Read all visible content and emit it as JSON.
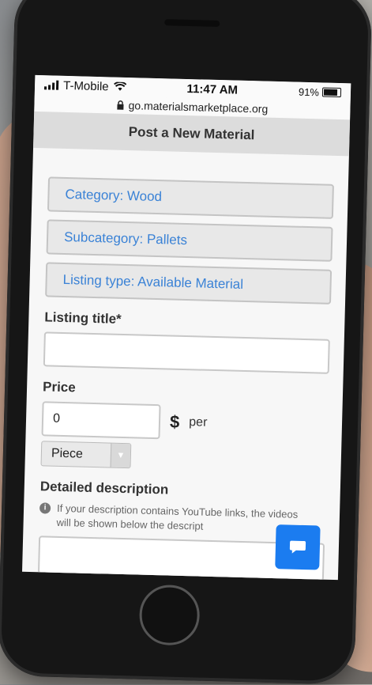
{
  "status_bar": {
    "carrier": "T-Mobile",
    "time": "11:47 AM",
    "battery": "91%"
  },
  "browser": {
    "url": "go.materialsmarketplace.org"
  },
  "header": {
    "title": "Post a New Material"
  },
  "form": {
    "category": "Category: Wood",
    "subcategory": "Subcategory: Pallets",
    "listing_type": "Listing type: Available Material",
    "listing_title_label": "Listing title*",
    "listing_title_value": "",
    "price_label": "Price",
    "price_value": "0",
    "currency": "$",
    "per": "per",
    "unit": "Piece",
    "description_label": "Detailed description",
    "description_note": "If your description contains YouTube links, the videos will be shown below the descript"
  },
  "icons": {
    "signal": "signal-icon",
    "wifi": "wifi-icon",
    "lock": "lock-icon",
    "info": "info-icon",
    "chat": "chat-icon",
    "caret": "chevron-down-icon"
  },
  "colors": {
    "link_blue": "#3a82d6",
    "chat_blue": "#1b7cf0",
    "header_bg": "#dcdcdc"
  }
}
